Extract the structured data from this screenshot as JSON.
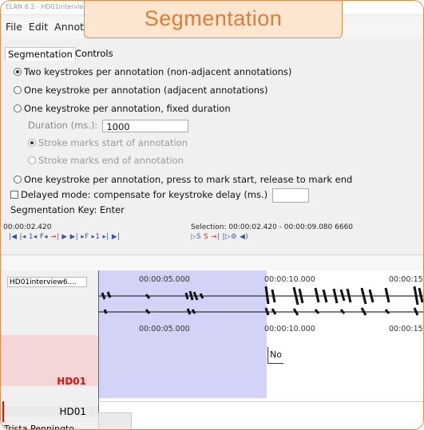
{
  "window": {
    "title": "ELAN 6.2 - HD01intervie"
  },
  "overlay": {
    "label": "Segmentation"
  },
  "menu": {
    "items": [
      "File",
      "Edit",
      "Annot"
    ]
  },
  "tabs": [
    {
      "label": "Segmentation"
    },
    {
      "label": "Controls"
    }
  ],
  "segmentation": {
    "options": [
      {
        "label": "Two keystrokes per annotation (non-adjacent annotations)",
        "selected": true,
        "enabled": true
      },
      {
        "label": "One keystroke per annotation (adjacent annotations)",
        "selected": false,
        "enabled": true
      },
      {
        "label": "One keystroke per annotation, fixed duration",
        "selected": false,
        "enabled": true
      },
      {
        "label": "Stroke marks start of annotation",
        "selected": true,
        "enabled": false
      },
      {
        "label": "Stroke marks end of annotation",
        "selected": false,
        "enabled": false
      },
      {
        "label": "One keystroke per annotation, press to mark start, release to mark end",
        "selected": false,
        "enabled": true
      }
    ],
    "duration_label": "Duration (ms.):",
    "duration_value": "1000",
    "delayed_mode_label": "Delayed mode: compensate for keystroke delay (ms.)",
    "delayed_mode_checked": false,
    "segmentation_key": "Segmentation Key:  Enter"
  },
  "player": {
    "current_time": "00:00:02.420",
    "selection_text": "Selection: 00:00:02.420 - 00:00:09.080  6660"
  },
  "timeline": {
    "labels": [
      "00:00:05.000",
      "00:00:10.000",
      "00:00:15"
    ],
    "waveform_file": "HD01interview6....",
    "tiers": [
      {
        "name": "HD01",
        "color": "#e01010"
      },
      {
        "name": "HD01",
        "color": "#222222"
      },
      {
        "name": "Trista Penningto",
        "color": "#222222"
      }
    ],
    "annotation_text": "No"
  },
  "colors": {
    "accent": "#e8894a",
    "selection": "#9696eb",
    "tier_active": "#e01010"
  }
}
